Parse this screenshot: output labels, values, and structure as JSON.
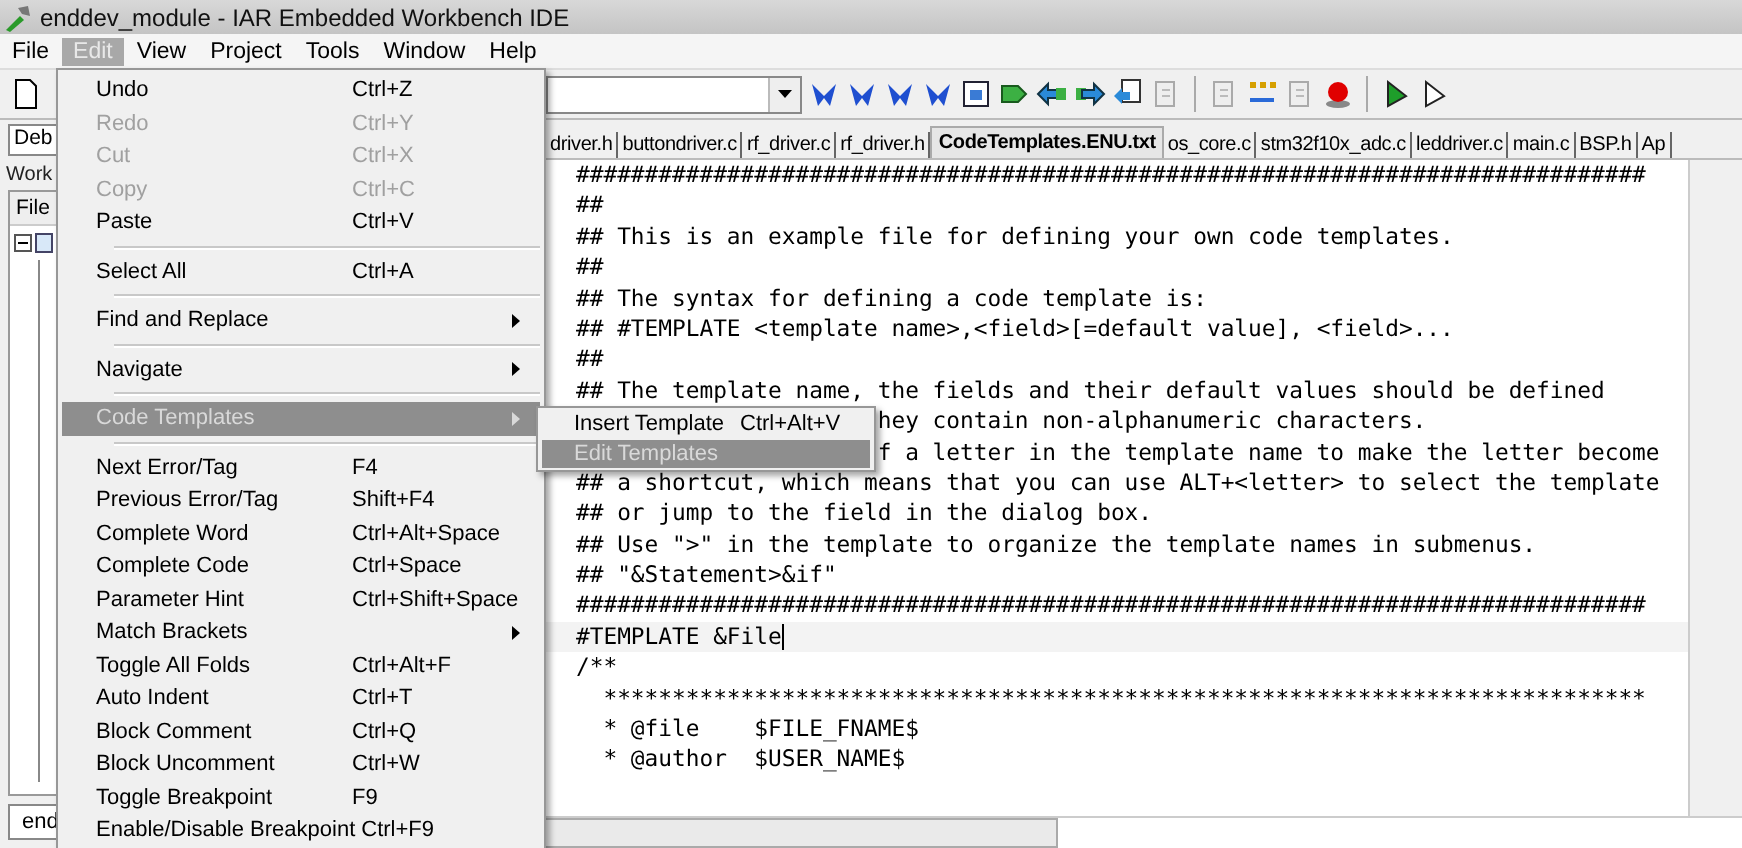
{
  "window": {
    "title": "enddev_module - IAR Embedded Workbench IDE"
  },
  "menubar": [
    {
      "label": "File",
      "selected": false
    },
    {
      "label": "Edit",
      "selected": true
    },
    {
      "label": "View",
      "selected": false
    },
    {
      "label": "Project",
      "selected": false
    },
    {
      "label": "Tools",
      "selected": false
    },
    {
      "label": "Window",
      "selected": false
    },
    {
      "label": "Help",
      "selected": false
    }
  ],
  "workspace": {
    "config": "Deb",
    "tab": "Work",
    "header": "File",
    "bottom_tab": "end"
  },
  "tabs": [
    {
      "label": "driver.h",
      "selected": false
    },
    {
      "label": "buttondriver.c",
      "selected": false
    },
    {
      "label": "rf_driver.c",
      "selected": false
    },
    {
      "label": "rf_driver.h",
      "selected": false
    },
    {
      "label": "CodeTemplates.ENU.txt",
      "selected": true
    },
    {
      "label": "os_core.c",
      "selected": false
    },
    {
      "label": "stm32f10x_adc.c",
      "selected": false
    },
    {
      "label": "leddriver.c",
      "selected": false
    },
    {
      "label": "main.c",
      "selected": false
    },
    {
      "label": "BSP.h",
      "selected": false
    },
    {
      "label": "Ap",
      "selected": false
    }
  ],
  "code": {
    "lines": [
      {
        "text": "##############################################################################",
        "current": false
      },
      {
        "text": "##",
        "current": false
      },
      {
        "text": "## This is an example file for defining your own code templates.",
        "current": false
      },
      {
        "text": "##",
        "current": false
      },
      {
        "text": "## The syntax for defining a code template is:",
        "current": false
      },
      {
        "text": "## #TEMPLATE <template name>,<field>[=default value], <field>...",
        "current": false
      },
      {
        "text": "##",
        "current": false
      },
      {
        "text": "## The template name, the fields and their default values should be defined",
        "current": false
      },
      {
        "text": "hey contain non-alphanumeric characters.",
        "current": false,
        "kind": "covered"
      },
      {
        "text": "f a letter in the template name to make the letter become",
        "current": false,
        "kind": "covered"
      },
      {
        "text": "## a shortcut, which means that you can use ALT+<letter> to select the template",
        "current": false
      },
      {
        "text": "## or jump to the field in the dialog box.",
        "current": false
      },
      {
        "text": "## Use \">\" in the template to organize the template names in submenus.",
        "current": false
      },
      {
        "text": "## \"&Statement>&if\"",
        "current": false
      },
      {
        "text": "##############################################################################",
        "current": false
      },
      {
        "text": "#TEMPLATE &File",
        "current": true
      },
      {
        "text": "/**",
        "current": false
      },
      {
        "text": "  ****************************************************************************",
        "current": false
      },
      {
        "text": "  * @file    $FILE_FNAME$",
        "current": false
      },
      {
        "text": "  * @author  $USER_NAME$",
        "current": false
      }
    ]
  },
  "edit_menu": {
    "items": [
      {
        "kind": "item",
        "label": "Undo",
        "shortcut": "Ctrl+Z",
        "disabled": false,
        "submenu": false,
        "selected": false
      },
      {
        "kind": "item",
        "label": "Redo",
        "shortcut": "Ctrl+Y",
        "disabled": true,
        "submenu": false,
        "selected": false
      },
      {
        "kind": "item",
        "label": "Cut",
        "shortcut": "Ctrl+X",
        "disabled": true,
        "submenu": false,
        "selected": false
      },
      {
        "kind": "item",
        "label": "Copy",
        "shortcut": "Ctrl+C",
        "disabled": true,
        "submenu": false,
        "selected": false
      },
      {
        "kind": "item",
        "label": "Paste",
        "shortcut": "Ctrl+V",
        "disabled": false,
        "submenu": false,
        "selected": false
      },
      {
        "kind": "separator"
      },
      {
        "kind": "item",
        "label": "Select All",
        "shortcut": "Ctrl+A",
        "disabled": false,
        "submenu": false,
        "selected": false
      },
      {
        "kind": "separator"
      },
      {
        "kind": "item",
        "label": "Find and Replace",
        "disabled": false,
        "submenu": true,
        "selected": false
      },
      {
        "kind": "separator"
      },
      {
        "kind": "item",
        "label": "Navigate",
        "disabled": false,
        "submenu": true,
        "selected": false
      },
      {
        "kind": "separator"
      },
      {
        "kind": "item",
        "label": "Code Templates",
        "disabled": false,
        "submenu": true,
        "selected": true
      },
      {
        "kind": "separator"
      },
      {
        "kind": "item",
        "label": "Next Error/Tag",
        "shortcut": "F4",
        "disabled": false,
        "submenu": false,
        "selected": false
      },
      {
        "kind": "item",
        "label": "Previous Error/Tag",
        "shortcut": "Shift+F4",
        "disabled": false,
        "submenu": false,
        "selected": false
      },
      {
        "kind": "item",
        "label": "Complete Word",
        "shortcut": "Ctrl+Alt+Space",
        "disabled": false,
        "submenu": false,
        "selected": false
      },
      {
        "kind": "item",
        "label": "Complete Code",
        "shortcut": "Ctrl+Space",
        "disabled": false,
        "submenu": false,
        "selected": false
      },
      {
        "kind": "item",
        "label": "Parameter Hint",
        "shortcut": "Ctrl+Shift+Space",
        "disabled": false,
        "submenu": false,
        "selected": false
      },
      {
        "kind": "item",
        "label": "Match Brackets",
        "disabled": false,
        "submenu": true,
        "selected": false
      },
      {
        "kind": "item",
        "label": "Toggle All Folds",
        "shortcut": "Ctrl+Alt+F",
        "disabled": false,
        "submenu": false,
        "selected": false
      },
      {
        "kind": "item",
        "label": "Auto Indent",
        "shortcut": "Ctrl+T",
        "disabled": false,
        "submenu": false,
        "selected": false
      },
      {
        "kind": "item",
        "label": "Block Comment",
        "shortcut": "Ctrl+Q",
        "disabled": false,
        "submenu": false,
        "selected": false
      },
      {
        "kind": "item",
        "label": "Block Uncomment",
        "shortcut": "Ctrl+W",
        "disabled": false,
        "submenu": false,
        "selected": false
      },
      {
        "kind": "item",
        "label": "Toggle Breakpoint",
        "shortcut": "F9",
        "disabled": false,
        "submenu": false,
        "selected": false
      },
      {
        "kind": "item",
        "label": "Enable/Disable Breakpoint",
        "shortcut": "Ctrl+F9",
        "disabled": false,
        "submenu": false,
        "selected": false
      }
    ]
  },
  "submenu": {
    "items": [
      {
        "label": "Insert Template",
        "shortcut": "Ctrl+Alt+V",
        "selected": false
      },
      {
        "label": "Edit Templates",
        "selected": true
      }
    ]
  }
}
